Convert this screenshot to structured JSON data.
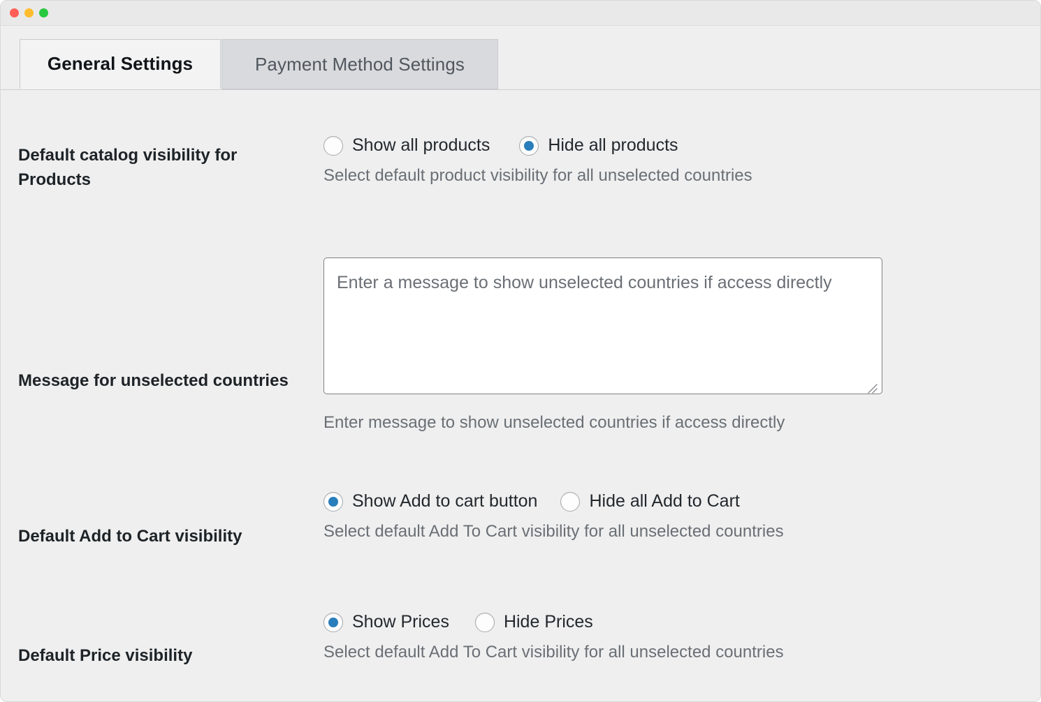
{
  "window": {
    "traffic_lights": [
      {
        "name": "close",
        "color": "#ff5f57"
      },
      {
        "name": "minimize",
        "color": "#febc2e"
      },
      {
        "name": "zoom",
        "color": "#28c840"
      }
    ]
  },
  "tabs": [
    {
      "id": "general-settings",
      "label": "General Settings",
      "active": true
    },
    {
      "id": "payment-method-settings",
      "label": "Payment Method Settings",
      "active": false
    }
  ],
  "accent_color": "#2a7ebb",
  "settings": {
    "catalog_visibility": {
      "label": "Default catalog visibility for Products",
      "options": [
        {
          "id": "show-all-products",
          "label": "Show all products",
          "checked": false
        },
        {
          "id": "hide-all-products",
          "label": "Hide all products",
          "checked": true
        }
      ],
      "help": "Select default product visibility for all unselected countries"
    },
    "unselected_message": {
      "label": "Message for unselected countries",
      "value": "",
      "placeholder": "Enter a message to show unselected countries if access directly",
      "help": "Enter message to show unselected countries if access directly"
    },
    "add_to_cart_visibility": {
      "label": "Default Add to Cart visibility",
      "options": [
        {
          "id": "show-add-to-cart-button",
          "label": "Show Add to cart button",
          "checked": true
        },
        {
          "id": "hide-all-add-to-cart",
          "label": "Hide all Add to Cart",
          "checked": false
        }
      ],
      "help": "Select default Add To Cart visibility for all unselected countries"
    },
    "price_visibility": {
      "label": "Default Price visibility",
      "options": [
        {
          "id": "show-prices",
          "label": "Show Prices",
          "checked": true
        },
        {
          "id": "hide-prices",
          "label": "Hide Prices",
          "checked": false
        }
      ],
      "help": "Select default Add To Cart visibility for all unselected countries"
    }
  }
}
